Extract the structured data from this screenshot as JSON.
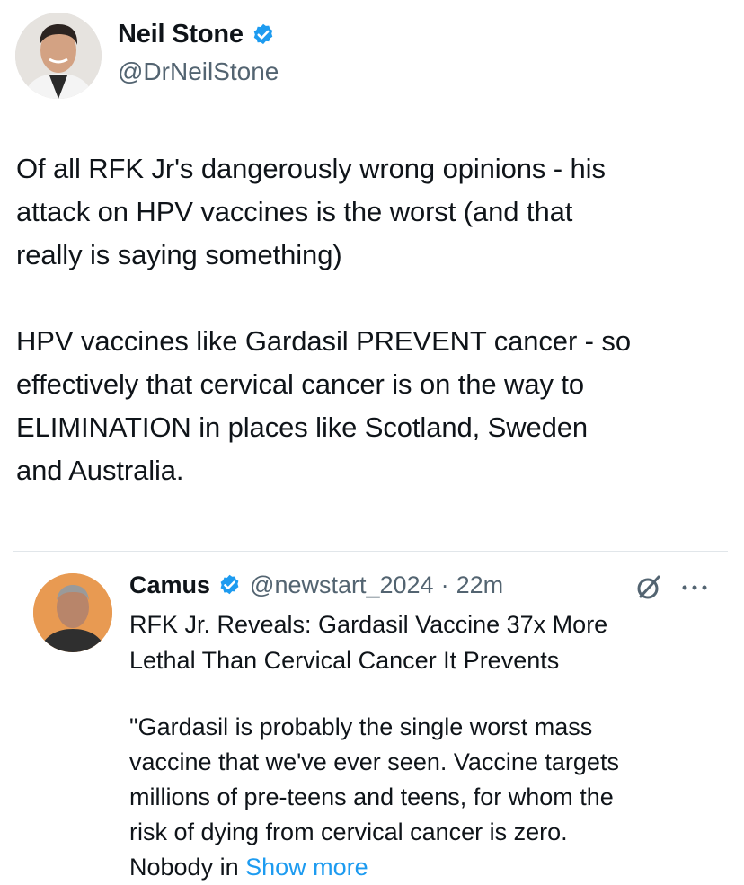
{
  "main_tweet": {
    "author_name": "Neil Stone",
    "author_handle": "@DrNeilStone",
    "verified": true,
    "text": "Of all RFK Jr's dangerously wrong opinions - his\nattack on HPV vaccines is the worst (and that\nreally is saying something)\n\nHPV vaccines like Gardasil PREVENT  cancer - so\neffectively that cervical cancer is on the way to\nELIMINATION in places like Scotland, Sweden\nand Australia."
  },
  "quoted_tweet": {
    "author_name": "Camus",
    "author_handle": "@newstart_2024",
    "separator": "·",
    "time": "22m",
    "verified": true,
    "title": "RFK Jr. Reveals: Gardasil Vaccine 37x More\nLethal Than Cervical Cancer It Prevents",
    "body": "\"Gardasil  is probably the single worst  mass\nvaccine that we've ever seen. Vaccine targets\nmillions of pre-teens and teens, for whom the\nrisk of dying from cervical cancer is zero.\nNobody in ",
    "show_more": "Show more"
  },
  "icons": {
    "verified": "verified-badge-icon",
    "grok": "grok-icon",
    "more": "more-options-icon"
  },
  "colors": {
    "text": "#0f1419",
    "secondary": "#536471",
    "link": "#1d9bf0",
    "verified": "#1d9bf0"
  }
}
